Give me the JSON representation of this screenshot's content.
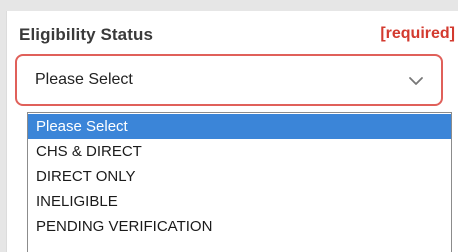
{
  "field": {
    "label": "Eligibility Status",
    "required_text": "[required]"
  },
  "select": {
    "current_value": "Please Select",
    "icon": "chevron-down-icon"
  },
  "dropdown": {
    "options": [
      {
        "label": "Please Select",
        "highlighted": true
      },
      {
        "label": "CHS & DIRECT",
        "highlighted": false
      },
      {
        "label": "DIRECT ONLY",
        "highlighted": false
      },
      {
        "label": "INELIGIBLE",
        "highlighted": false
      },
      {
        "label": "PENDING VERIFICATION",
        "highlighted": false
      }
    ]
  },
  "colors": {
    "highlight": "#3b85d8",
    "required": "#d33a2f",
    "error_border": "#e0605a"
  }
}
